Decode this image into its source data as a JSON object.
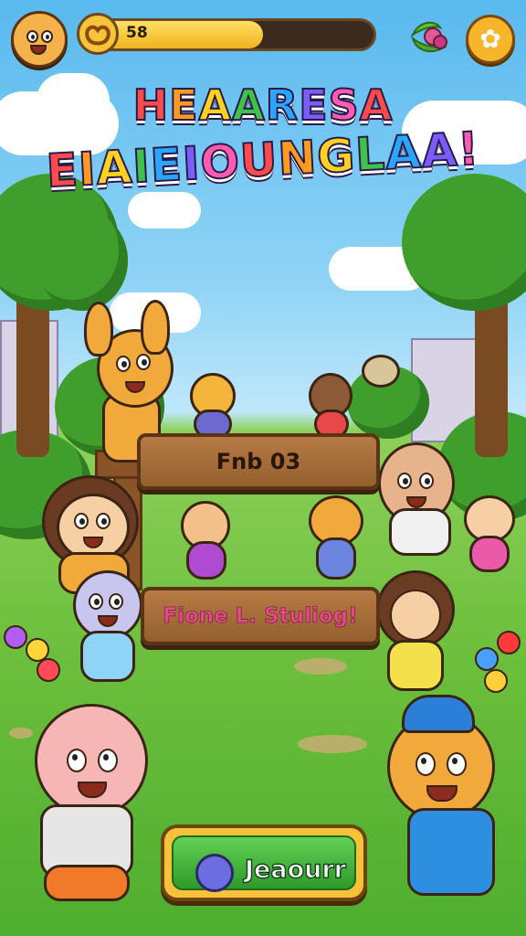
{
  "hud": {
    "progress_value": "58",
    "progress_fraction": 0.62
  },
  "title": {
    "line1": [
      "H",
      "E",
      "A",
      "A",
      "R",
      "E",
      "S",
      "A"
    ],
    "line2": [
      "E",
      "I",
      "A",
      "I",
      "E",
      "I",
      "O",
      "U",
      "N",
      "G",
      "L",
      "A",
      "A",
      "!"
    ],
    "colors": [
      "#ff4a4a",
      "#ff9a1f",
      "#ffd21f",
      "#3fc24a",
      "#2aa6ff",
      "#7a5cff",
      "#ff5bb0"
    ]
  },
  "signs": {
    "top": "Fnb 03",
    "bottom": "Fione L. Stuliog!"
  },
  "play_button": {
    "label": "Jeaourr"
  },
  "icons": {
    "avatar": "kangaroo-face-icon",
    "progress": "pretzel-icon",
    "berry": "berry-icon",
    "settings": "gear-icon",
    "play": "lollipop-icon"
  },
  "colors": {
    "progress_fill": "#f0b21d",
    "play_green": "#3fb535",
    "sign_wood": "#a96d3a"
  }
}
